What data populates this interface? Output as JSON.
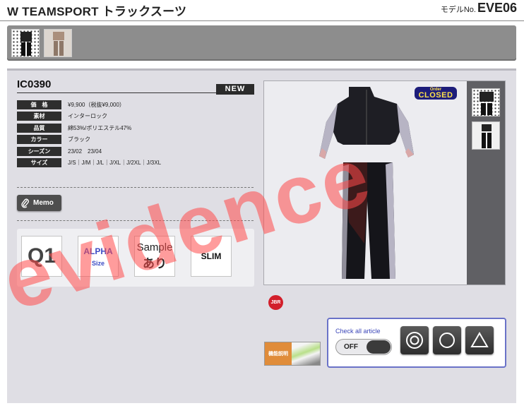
{
  "header": {
    "title": "W TEAMSPORT トラックスーツ",
    "model_label": "モデルNo.",
    "model_number": "EVE06"
  },
  "product": {
    "code": "IC0390",
    "badge": "NEW",
    "specs": [
      {
        "label": "価　格",
        "value": "¥9,900（税抜¥9,000）"
      },
      {
        "label": "素材",
        "value": "インターロック"
      },
      {
        "label": "品質",
        "value": "綿53%/ポリエステル47%"
      },
      {
        "label": "カラー",
        "value": "ブラック"
      },
      {
        "label": "シーズン",
        "value": "23/02　23/04"
      },
      {
        "label": "サイズ",
        "value": "J/S｜J/M｜J/L｜J/XL｜J/2XL｜J/3XL"
      }
    ],
    "memo_label": "Memo"
  },
  "feature_icons": {
    "q1": "Q1",
    "alpha_top": "ALPHA",
    "alpha_bottom": "Size",
    "sample_top": "Sample",
    "sample_bottom": "あり",
    "slim": "SLIM"
  },
  "image_panel": {
    "closed_top": "Order",
    "closed_bottom": "CLOSED"
  },
  "jbr_label": "JBR",
  "kino_label": "機能説明",
  "check": {
    "title": "Check all article",
    "toggle_label": "OFF"
  },
  "watermark": "evidence",
  "colors": {
    "accent": "#3a45b8",
    "watermark": "#ff4b4b",
    "label_bg": "#2e2e2e"
  }
}
